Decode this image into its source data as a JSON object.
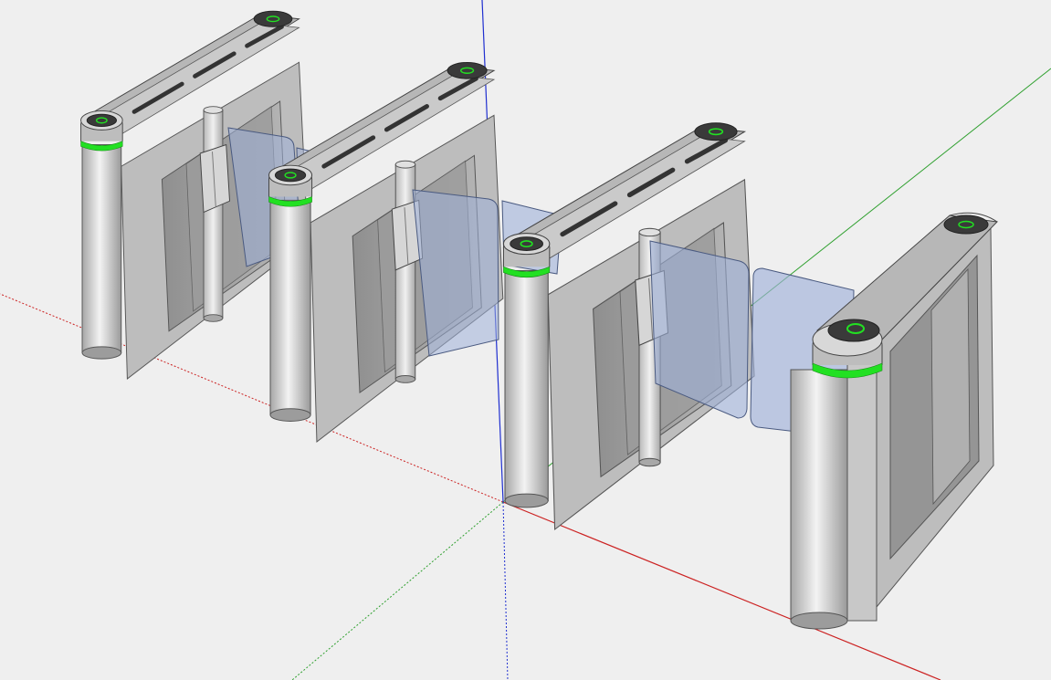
{
  "viewport": {
    "background_color": "#efefef",
    "axes": {
      "red_axis_color": "#cc2222",
      "green_axis_color": "#2fa02f",
      "blue_axis_color": "#1f2fd0"
    }
  },
  "model": {
    "turnstile_units": 4,
    "glass_swing_doors": 5,
    "indicator_light_color": "#22e022",
    "housing_color": "#cfcfcf",
    "glass_color": "#9fb0d8",
    "reader_pad_color": "#3a3a3a"
  }
}
